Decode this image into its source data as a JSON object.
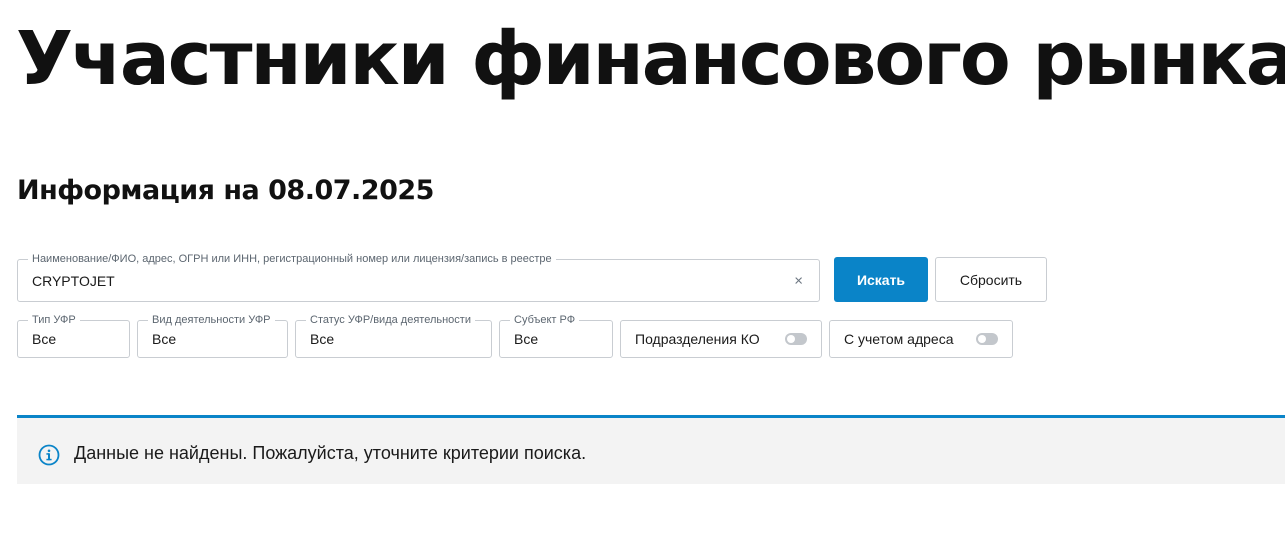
{
  "page": {
    "title": "Участники финансового рынка",
    "subtitle": "Информация на 08.07.2025"
  },
  "search": {
    "label": "Наименование/ФИО, адрес, ОГРН или ИНН, регистрационный номер или лицензия/запись в реестре",
    "value": "CRYPTOJET",
    "clear_icon": "×",
    "search_button": "Искать",
    "reset_button": "Сбросить"
  },
  "filters": {
    "type": {
      "label": "Тип УФР",
      "value": "Все"
    },
    "activity": {
      "label": "Вид деятельности УФР",
      "value": "Все"
    },
    "status": {
      "label": "Статус УФР/вида деятельности",
      "value": "Все"
    },
    "region": {
      "label": "Субъект РФ",
      "value": "Все"
    }
  },
  "toggles": {
    "ko_divisions": {
      "label": "Подразделения КО",
      "on": false
    },
    "with_address": {
      "label": "С учетом адреса",
      "on": false
    }
  },
  "notice": {
    "icon": "info-icon",
    "text": "Данные не найдены. Пожалуйста, уточните критерии поиска."
  },
  "colors": {
    "accent": "#0a84c8",
    "notice_bg": "#f3f3f3",
    "border": "#c9cdd2"
  }
}
